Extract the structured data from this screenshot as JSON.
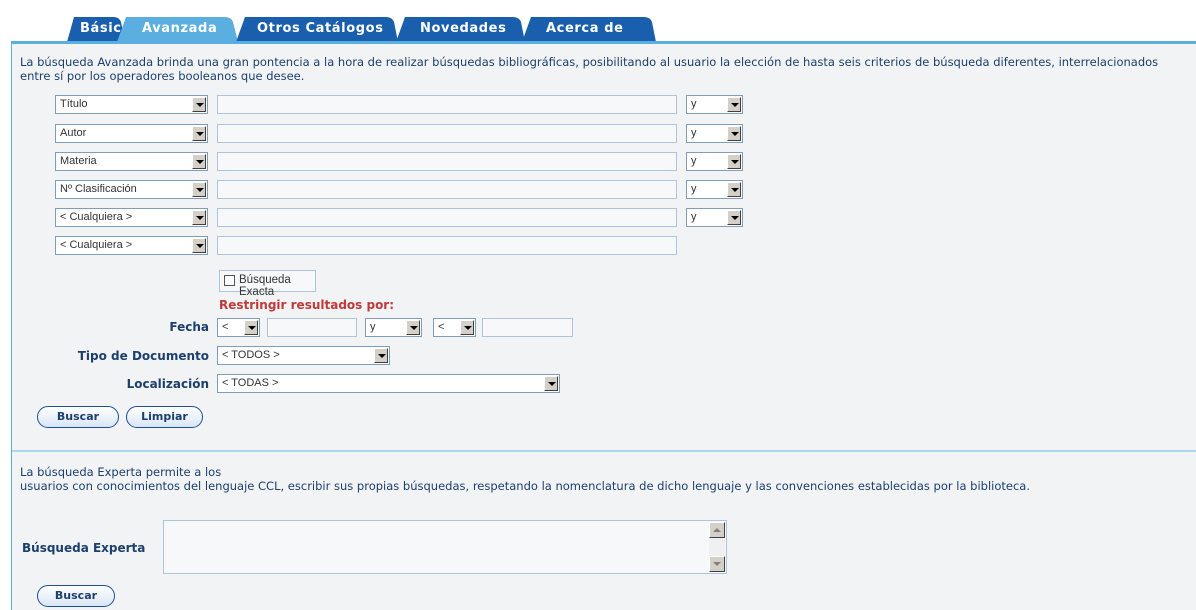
{
  "tabs": [
    {
      "label": "Básica"
    },
    {
      "label": "Avanzada"
    },
    {
      "label": "Otros Catálogos"
    },
    {
      "label": "Novedades"
    },
    {
      "label": "Acerca de"
    }
  ],
  "intro_text": "La búsqueda Avanzada brinda una gran pontencia a la hora de realizar búsquedas bibliográficas, posibilitando al usuario la elección de hasta seis criterios de búsqueda diferentes, interrelacionados entre sí por los operadores booleanos que desee.",
  "criteria": [
    {
      "field": "Título",
      "operator": "y"
    },
    {
      "field": "Autor",
      "operator": "y"
    },
    {
      "field": "Materia",
      "operator": "y"
    },
    {
      "field": "Nº Clasificación",
      "operator": "y"
    },
    {
      "field": "< Cualquiera >",
      "operator": "y"
    },
    {
      "field": "< Cualquiera >"
    }
  ],
  "exact_search_label": "Búsqueda Exacta",
  "restrict_label": "Restringir resultados por:",
  "fecha": {
    "label": "Fecha",
    "op1": "<",
    "conj": "y",
    "op2": "<"
  },
  "tipo_documento": {
    "label": "Tipo de Documento",
    "value": "< TODOS >"
  },
  "localizacion": {
    "label": "Localización",
    "value": "< TODAS >"
  },
  "buttons": {
    "search": "Buscar",
    "clear": "Limpiar"
  },
  "expert": {
    "text_line1": "La búsqueda Experta permite a los",
    "text_line2": "usuarios con conocimientos del lenguaje CCL, escribir sus propias búsquedas, respetando la nomenclatura de dicho lenguaje y las convenciones establecidas por la biblioteca.",
    "label": "Búsqueda Experta",
    "search_button": "Buscar"
  },
  "colors": {
    "accent": "#5aaee0",
    "tab_inactive": "#1a5fae",
    "tab_active": "#5aaee0",
    "restrict": "#c03a3a"
  }
}
